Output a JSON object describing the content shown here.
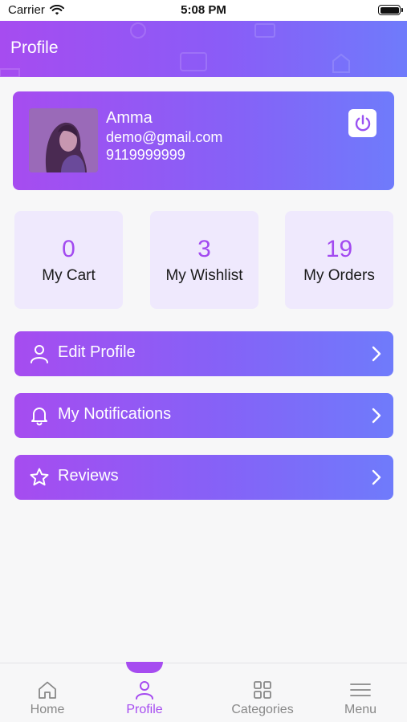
{
  "status_bar": {
    "carrier": "Carrier",
    "time": "5:08 PM"
  },
  "header": {
    "title": "Profile"
  },
  "user": {
    "name": "Amma",
    "email": "demo@gmail.com",
    "phone": "9119999999"
  },
  "stats": [
    {
      "value": "0",
      "label": "My Cart"
    },
    {
      "value": "3",
      "label": "My Wishlist"
    },
    {
      "value": "19",
      "label": "My Orders"
    }
  ],
  "menu": [
    {
      "label": "Edit Profile",
      "icon": "user-icon"
    },
    {
      "label": "My Notifications",
      "icon": "bell-icon"
    },
    {
      "label": "Reviews",
      "icon": "star-icon"
    }
  ],
  "tabs": [
    {
      "label": "Home",
      "icon": "home-icon",
      "active": false
    },
    {
      "label": "Profile",
      "icon": "user-icon",
      "active": true
    },
    {
      "label": "Categories",
      "icon": "grid-icon",
      "active": false
    },
    {
      "label": "Menu",
      "icon": "hamburger-icon",
      "active": false
    }
  ],
  "colors": {
    "accent": "#a64cf0",
    "gradient_end": "#6f7bfb",
    "stat_bg": "#efe9fd",
    "inactive": "#888888"
  }
}
